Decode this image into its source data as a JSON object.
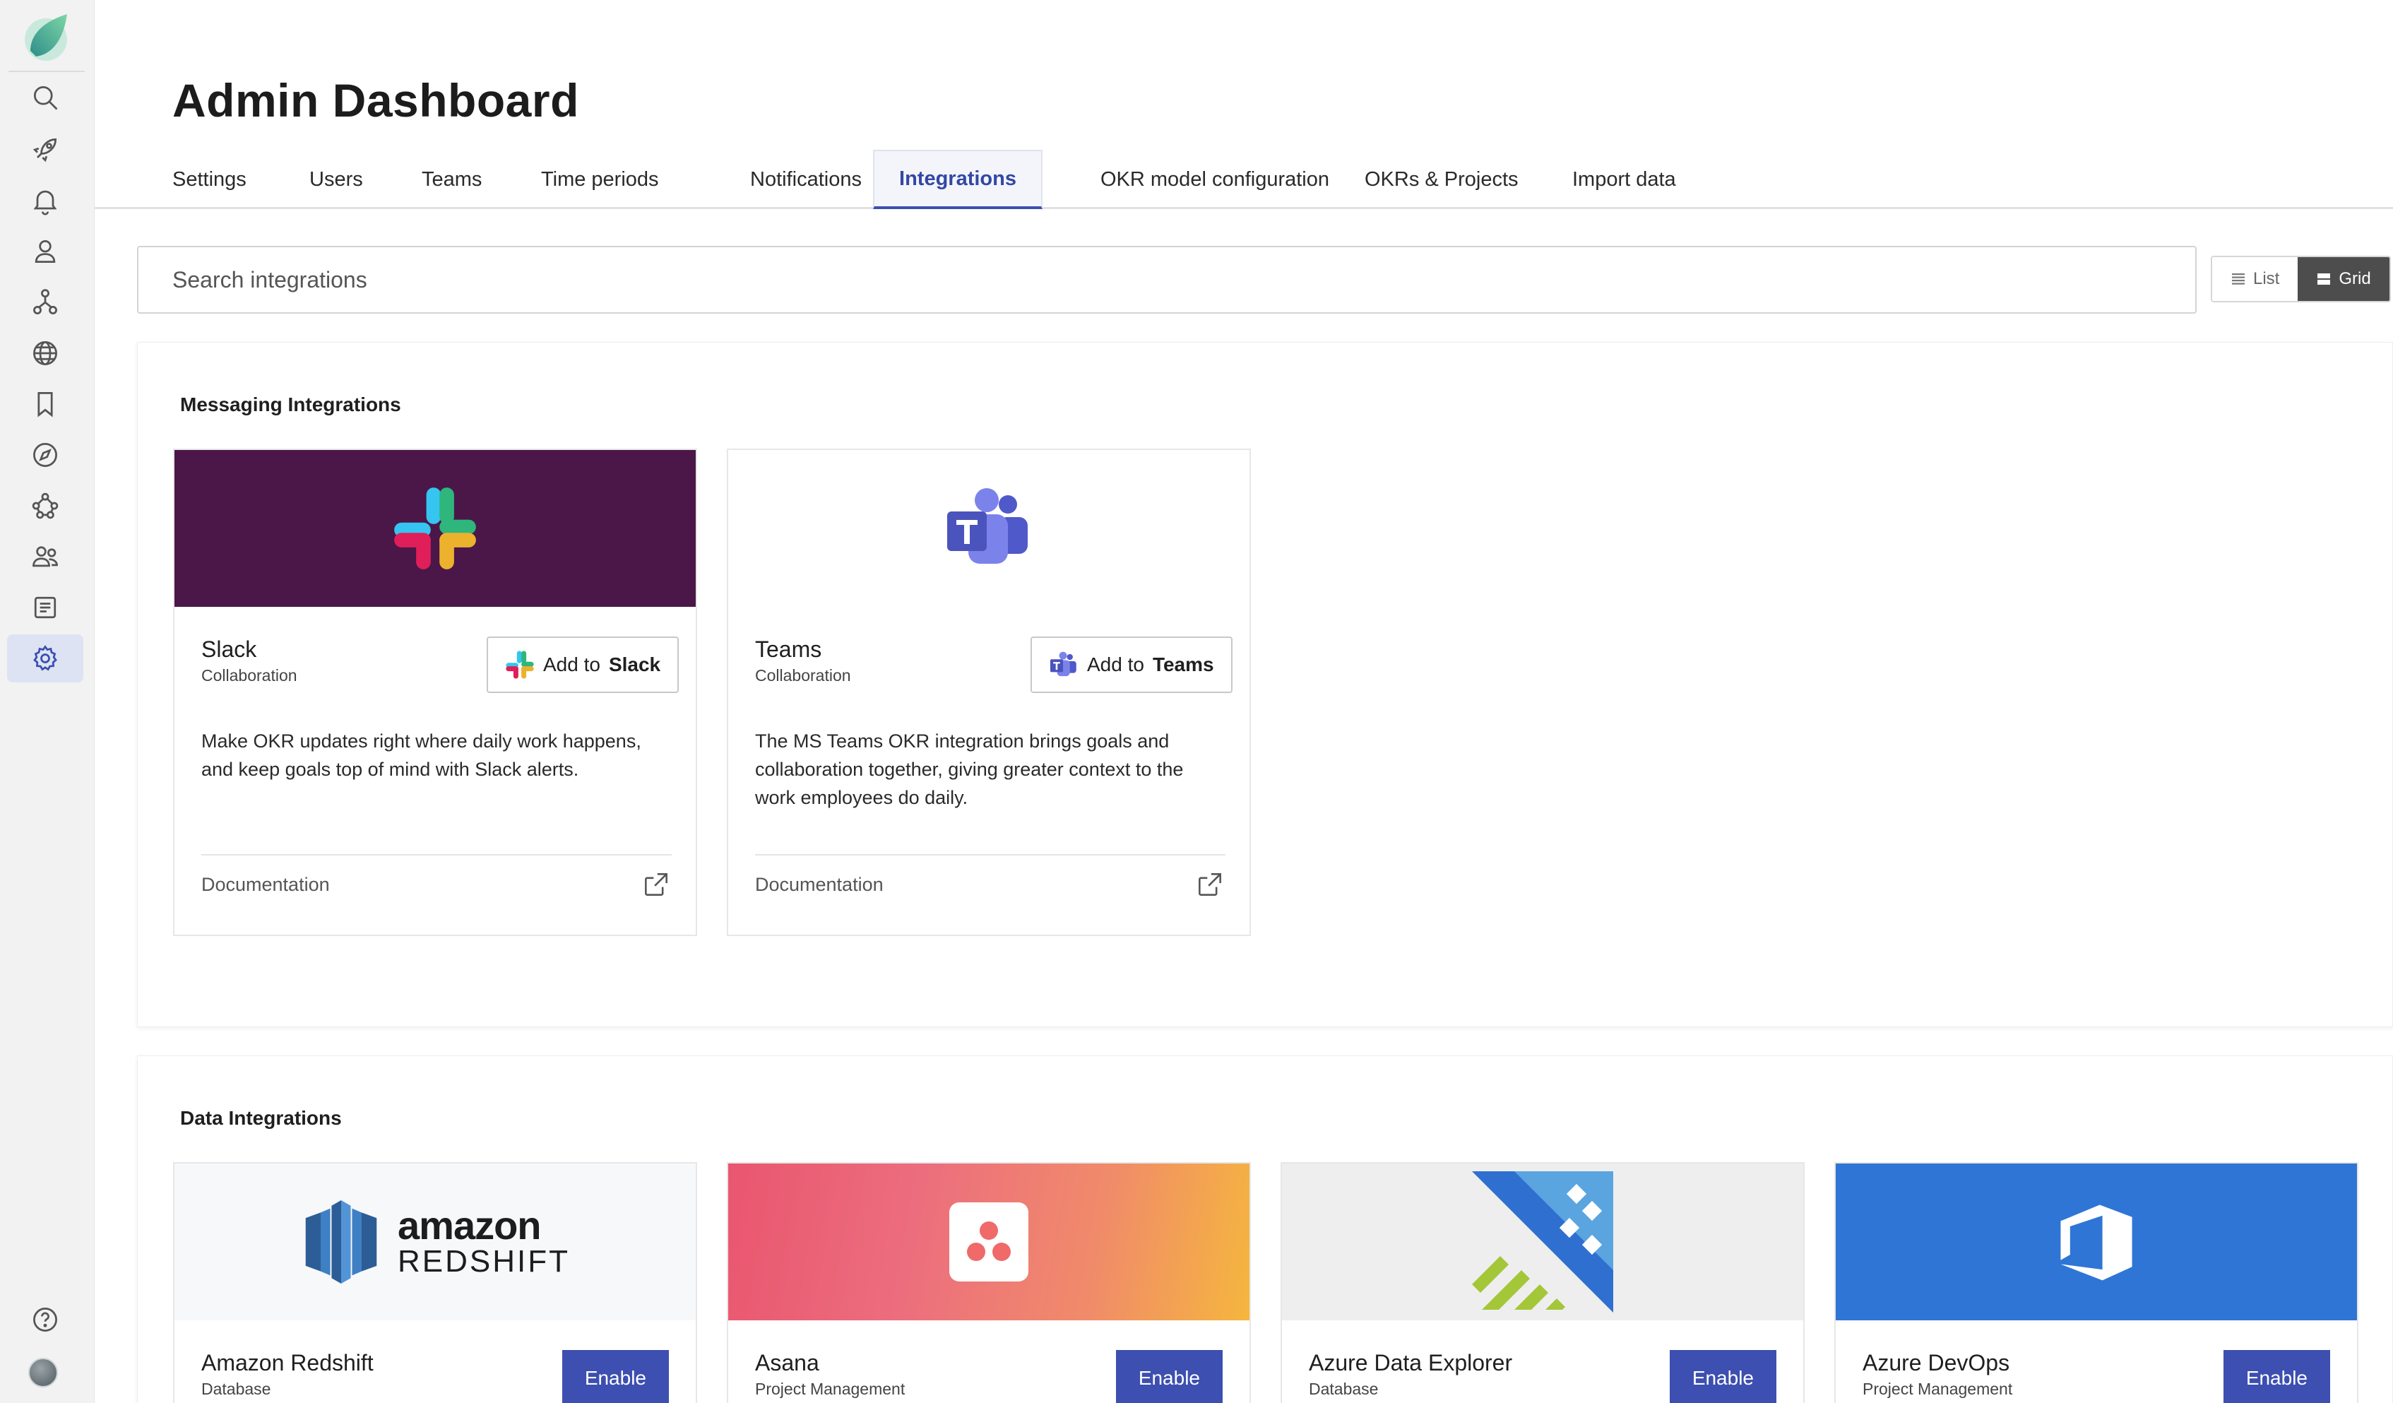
{
  "header": {
    "title": "Admin Dashboard"
  },
  "tabs": [
    {
      "label": "Settings"
    },
    {
      "label": "Users"
    },
    {
      "label": "Teams"
    },
    {
      "label": "Time periods"
    },
    {
      "label": "Notifications"
    },
    {
      "label": "Integrations",
      "active": true
    },
    {
      "label": "OKR model configuration"
    },
    {
      "label": "OKRs & Projects"
    },
    {
      "label": "Import data"
    }
  ],
  "search": {
    "placeholder": "Search integrations",
    "value": ""
  },
  "view_toggle": {
    "list_label": "List",
    "grid_label": "Grid",
    "selected": "Grid"
  },
  "sidebar": {
    "items": [
      {
        "icon": "search-icon"
      },
      {
        "icon": "rocket-icon"
      },
      {
        "icon": "bell-icon"
      },
      {
        "icon": "person-icon"
      },
      {
        "icon": "hierarchy-icon"
      },
      {
        "icon": "globe-icon"
      },
      {
        "icon": "bookmark-icon"
      },
      {
        "icon": "compass-icon"
      },
      {
        "icon": "org-network-icon"
      },
      {
        "icon": "people-icon"
      },
      {
        "icon": "document-list-icon"
      },
      {
        "icon": "gear-icon",
        "active": true
      }
    ],
    "bottom": [
      {
        "icon": "help-icon"
      },
      {
        "icon": "avatar"
      }
    ]
  },
  "messaging": {
    "title": "Messaging Integrations",
    "cards": [
      {
        "name": "Slack",
        "category": "Collaboration",
        "button_prefix": "Add to",
        "button_brand": "Slack",
        "description": "Make OKR updates right where daily work happens, and keep goals top of mind with Slack alerts.",
        "doc_label": "Documentation",
        "banner_color": "#4a1748"
      },
      {
        "name": "Teams",
        "category": "Collaboration",
        "button_prefix": "Add to",
        "button_brand": "Teams",
        "description": "The MS Teams OKR integration brings goals and collaboration together, giving greater context to the work employees do daily.",
        "doc_label": "Documentation",
        "banner_color": "#ffffff"
      }
    ]
  },
  "data_integrations": {
    "title": "Data Integrations",
    "cards": [
      {
        "name": "Amazon Redshift",
        "category": "Database",
        "button": "Enable",
        "logo_line1": "amazon",
        "logo_line2": "REDSHIFT"
      },
      {
        "name": "Asana",
        "category": "Project Management",
        "button": "Enable"
      },
      {
        "name": "Azure Data Explorer",
        "category": "Database",
        "button": "Enable"
      },
      {
        "name": "Azure DevOps",
        "category": "Project Management",
        "button": "Enable"
      }
    ]
  },
  "colors": {
    "accent": "#3d4fb0",
    "active_tab_text": "#3347a5",
    "slack_banner": "#4a1748",
    "azure_devops_banner": "#2f75d6",
    "asana_gradient_start": "#ec5f75",
    "asana_gradient_end": "#f5b63e"
  }
}
